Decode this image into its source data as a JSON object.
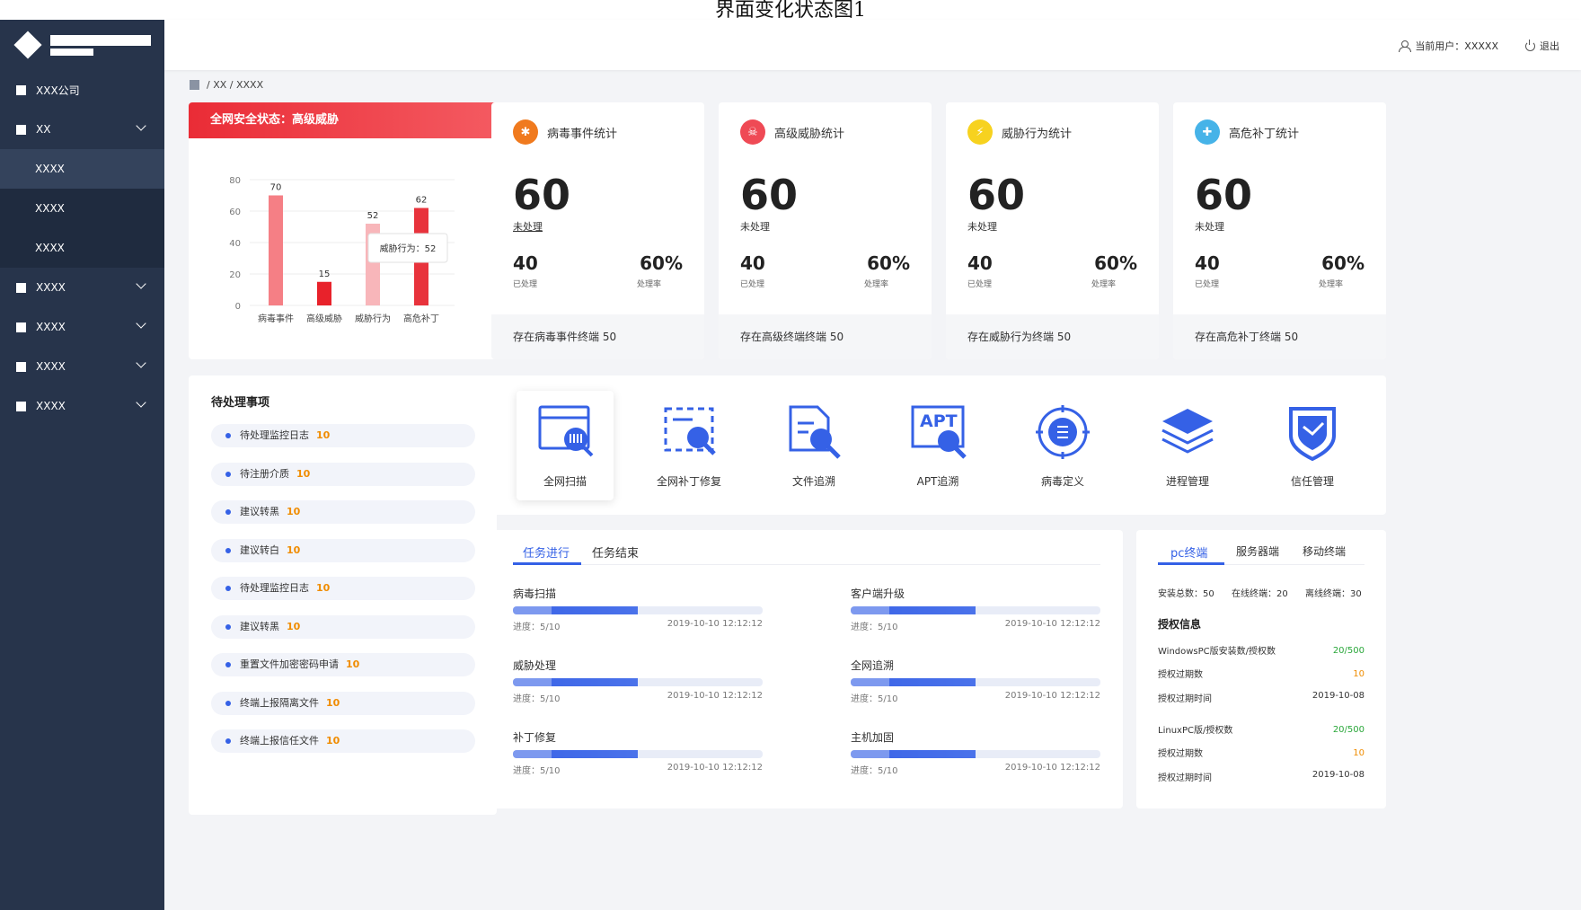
{
  "caption": "界面变化状态图1",
  "sidebar": {
    "items": [
      {
        "label": "XXX公司",
        "chevron": false
      },
      {
        "label": "XX",
        "chevron": true
      },
      {
        "label": "XXXX",
        "chevron": true
      },
      {
        "label": "XXXX",
        "chevron": true
      },
      {
        "label": "XXXX",
        "chevron": true
      },
      {
        "label": "XXXX",
        "chevron": true
      }
    ],
    "subitems": [
      "XXXX",
      "XXXX",
      "XXXX"
    ]
  },
  "topbar": {
    "user": "当前用户：XXXXX",
    "logout": "退出"
  },
  "breadcrumb": "/ XX / XXXX",
  "threat": {
    "title": "全网安全状态：高级威胁",
    "tooltip": "威胁行为：52"
  },
  "chart_data": {
    "type": "bar",
    "categories": [
      "病毒事件",
      "高级威胁",
      "威胁行为",
      "高危补丁"
    ],
    "values": [
      70,
      15,
      52,
      62
    ],
    "ylim": [
      0,
      80
    ],
    "yticks": [
      "0",
      "20",
      "40",
      "60",
      "80"
    ],
    "colors": [
      "#f57f85",
      "#e8222b",
      "#f8b6ba",
      "#e8333c"
    ],
    "grid": true,
    "legend": "none"
  },
  "stats": [
    {
      "title": "病毒事件统计",
      "icon": "bug-icon",
      "color": "#f07a1e",
      "glyph": "✱",
      "big": "60",
      "big_label": "未处理",
      "done": "40",
      "done_label": "已处理",
      "rate": "60%",
      "rate_label": "处理率",
      "footer": "存在病毒事件终端  50"
    },
    {
      "title": "高级威胁统计",
      "icon": "skull-icon",
      "color": "#ef4a55",
      "glyph": "☠",
      "big": "60",
      "big_label": "未处理",
      "done": "40",
      "done_label": "已处理",
      "rate": "60%",
      "rate_label": "处理率",
      "footer": "存在高级终端终端  50"
    },
    {
      "title": "威胁行为统计",
      "icon": "lightning-icon",
      "color": "#f7d21f",
      "glyph": "⚡",
      "big": "60",
      "big_label": "未处理",
      "done": "40",
      "done_label": "已处理",
      "rate": "60%",
      "rate_label": "处理率",
      "footer": "存在威胁行为终端  50"
    },
    {
      "title": "高危补丁统计",
      "icon": "wrench-icon",
      "color": "#46b3e8",
      "glyph": "✚",
      "big": "60",
      "big_label": "未处理",
      "done": "40",
      "done_label": "已处理",
      "rate": "60%",
      "rate_label": "处理率",
      "footer": "存在高危补丁终端  50"
    }
  ],
  "pending": {
    "title": "待处理事项",
    "items": [
      {
        "label": "待处理监控日志",
        "count": "10"
      },
      {
        "label": "待注册介质",
        "count": "10"
      },
      {
        "label": "建议转黑",
        "count": "10"
      },
      {
        "label": "建议转白",
        "count": "10"
      },
      {
        "label": "待处理监控日志",
        "count": "10"
      },
      {
        "label": "建议转黑",
        "count": "10"
      },
      {
        "label": "重置文件加密密码申请",
        "count": "10"
      },
      {
        "label": "终端上报隔离文件",
        "count": "10"
      },
      {
        "label": "终端上报信任文件",
        "count": "10"
      }
    ]
  },
  "tools": [
    {
      "label": "全网扫描",
      "icon": "scan-icon"
    },
    {
      "label": "全网补丁修复",
      "icon": "patch-repair-icon"
    },
    {
      "label": "文件追溯",
      "icon": "file-trace-icon"
    },
    {
      "label": "APT追溯",
      "icon": "apt-trace-icon",
      "text": "APT"
    },
    {
      "label": "病毒定义",
      "icon": "virus-icon"
    },
    {
      "label": "进程管理",
      "icon": "layers-icon"
    },
    {
      "label": "信任管理",
      "icon": "shield-icon"
    }
  ],
  "tasks": {
    "tabs": [
      "任务进行",
      "任务结束"
    ],
    "items": [
      {
        "name": "病毒扫描",
        "progress_label": "进度：5/10",
        "time": "2019-10-10 12:12:12",
        "progress": 0.5
      },
      {
        "name": "客户端升级",
        "progress_label": "进度：5/10",
        "time": "2019-10-10 12:12:12",
        "progress": 0.5
      },
      {
        "name": "威胁处理",
        "progress_label": "进度：5/10",
        "time": "2019-10-10 12:12:12",
        "progress": 0.5
      },
      {
        "name": "全网追溯",
        "progress_label": "进度：5/10",
        "time": "2019-10-10 12:12:12",
        "progress": 0.5
      },
      {
        "name": "补丁修复",
        "progress_label": "进度：5/10",
        "time": "2019-10-10 12:12:12",
        "progress": 0.5
      },
      {
        "name": "主机加固",
        "progress_label": "进度：5/10",
        "time": "2019-10-10 12:12:12",
        "progress": 0.5
      }
    ]
  },
  "auth": {
    "tabs": [
      "pc终端",
      "服务器端",
      "移动终端"
    ],
    "installed": "安装总数：50",
    "online": "在线终端：20",
    "offline": "离线终端：30",
    "section": "授权信息",
    "rows": [
      {
        "label": "WindowsPC版安装数/授权数",
        "value": "20/500",
        "tone": "green"
      },
      {
        "label": "授权过期数",
        "value": "10",
        "tone": "orange"
      },
      {
        "label": "授权过期时间",
        "value": "2019-10-08",
        "tone": "plain"
      },
      {
        "label": "LinuxPC版/授权数",
        "value": "20/500",
        "tone": "green"
      },
      {
        "label": "授权过期数",
        "value": "10",
        "tone": "orange"
      },
      {
        "label": "授权过期时间",
        "value": "2019-10-08",
        "tone": "plain"
      }
    ]
  }
}
